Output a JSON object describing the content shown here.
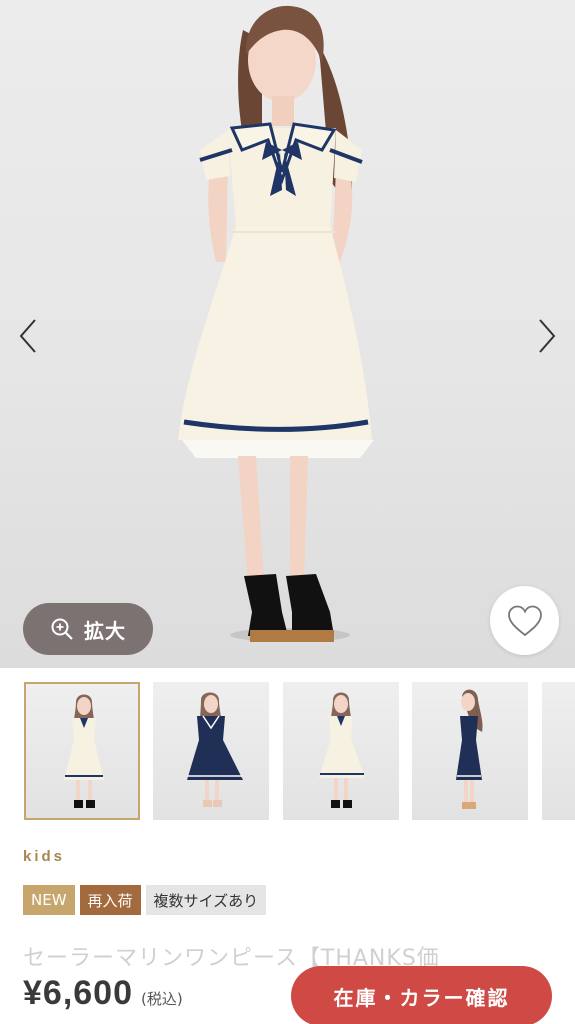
{
  "gallery": {
    "zoom_label": "拡大",
    "icons": {
      "prev": "chevron-left-icon",
      "next": "chevron-right-icon",
      "zoom": "magnifier-plus-icon",
      "favorite": "heart-outline-icon"
    },
    "thumbnails": [
      {
        "variant": "ivory",
        "selected": true
      },
      {
        "variant": "navy",
        "selected": false
      },
      {
        "variant": "ivory",
        "selected": false
      },
      {
        "variant": "navy-side",
        "selected": false
      },
      {
        "variant": "partial",
        "selected": false
      }
    ]
  },
  "product": {
    "brand": "kids",
    "tags": [
      "NEW",
      "再入荷",
      "複数サイズあり"
    ],
    "title": "セーラーマリンワンピース【THANKS価",
    "price": "¥6,600",
    "tax_note": "(税込)",
    "cta_label": "在庫・カラー確認"
  },
  "colors": {
    "accent_gold": "#c6a66d",
    "restock_brown": "#a36a3e",
    "cta_red": "#cf4a44",
    "zoom_button": "#7d7272"
  }
}
